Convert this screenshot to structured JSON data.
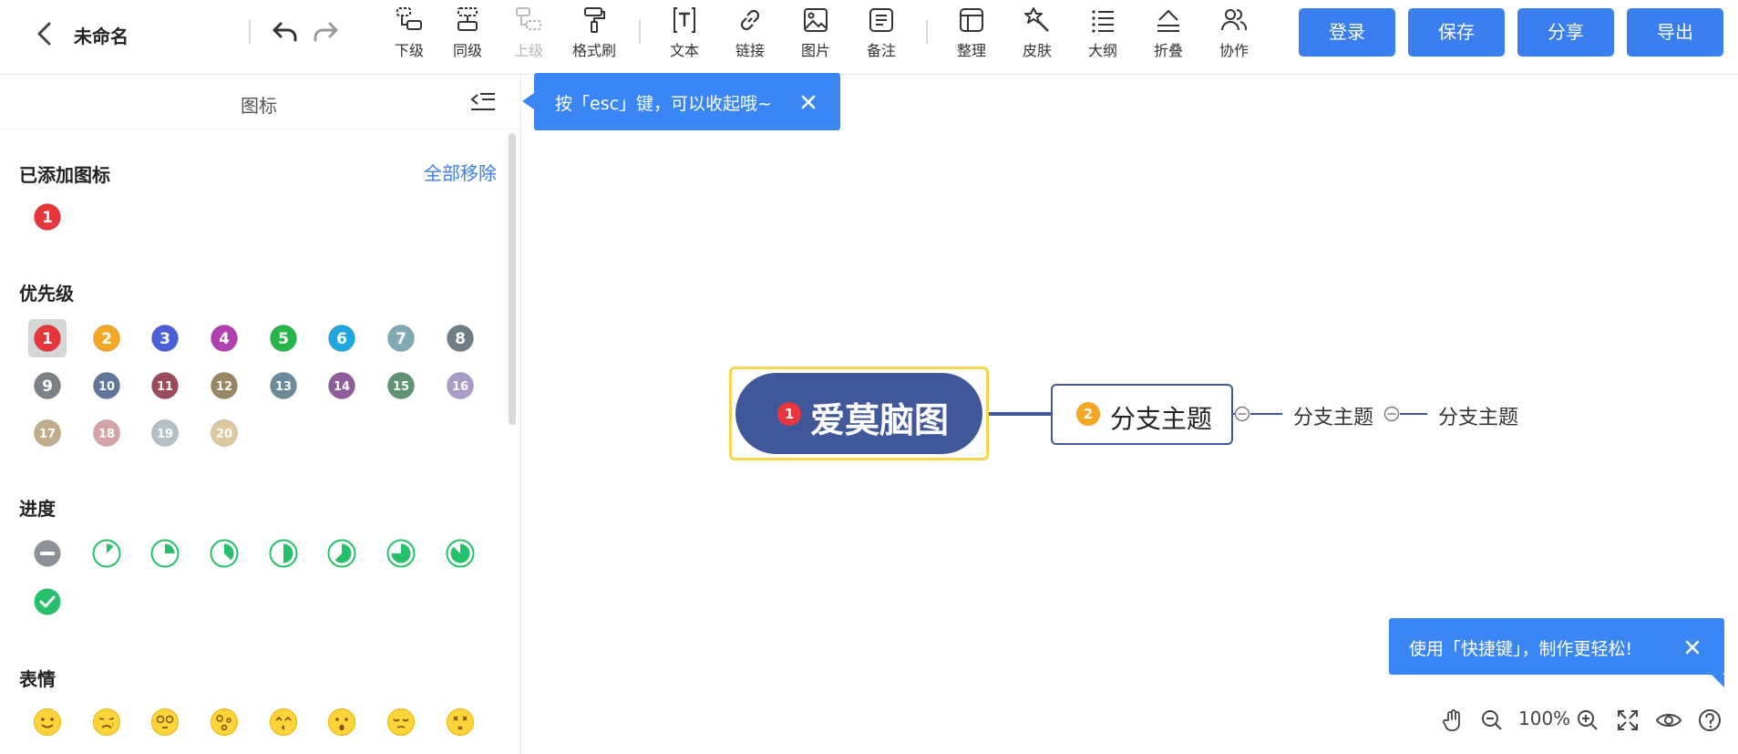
{
  "header": {
    "doc_title": "未命名",
    "tools": [
      {
        "label": "下级",
        "icon": "child-topic-icon"
      },
      {
        "label": "同级",
        "icon": "sibling-topic-icon"
      },
      {
        "label": "上级",
        "icon": "parent-topic-icon"
      },
      {
        "label": "格式刷",
        "icon": "format-brush-icon"
      },
      {
        "label": "文本",
        "icon": "text-icon"
      },
      {
        "label": "链接",
        "icon": "link-icon"
      },
      {
        "label": "图片",
        "icon": "image-icon"
      },
      {
        "label": "备注",
        "icon": "note-icon"
      },
      {
        "label": "整理",
        "icon": "layout-icon"
      },
      {
        "label": "皮肤",
        "icon": "skin-icon"
      },
      {
        "label": "大纲",
        "icon": "outline-icon"
      },
      {
        "label": "折叠",
        "icon": "fold-icon"
      },
      {
        "label": "协作",
        "icon": "collaborate-icon"
      }
    ],
    "buttons": {
      "login": "登录",
      "save": "保存",
      "share": "分享",
      "export": "导出"
    }
  },
  "sidebar": {
    "title": "图标",
    "added_title": "已添加图标",
    "remove_all": "全部移除",
    "added_icons": [
      "1"
    ],
    "priority_title": "优先级",
    "priority": [
      {
        "n": "1",
        "color": "#e8363c"
      },
      {
        "n": "2",
        "color": "#f5a623"
      },
      {
        "n": "3",
        "color": "#4a5fd8"
      },
      {
        "n": "4",
        "color": "#b23fb0"
      },
      {
        "n": "5",
        "color": "#27b54a"
      },
      {
        "n": "6",
        "color": "#1fa8e0"
      },
      {
        "n": "7",
        "color": "#7fa9b3"
      },
      {
        "n": "8",
        "color": "#6f7d86"
      },
      {
        "n": "9",
        "color": "#7a8288"
      },
      {
        "n": "10",
        "color": "#5f7799"
      },
      {
        "n": "11",
        "color": "#9b4b5c"
      },
      {
        "n": "12",
        "color": "#9a8662"
      },
      {
        "n": "13",
        "color": "#6a8a9c"
      },
      {
        "n": "14",
        "color": "#8e5d9a"
      },
      {
        "n": "15",
        "color": "#5e9470"
      },
      {
        "n": "16",
        "color": "#a99ac8"
      },
      {
        "n": "17",
        "color": "#c2ad8a"
      },
      {
        "n": "18",
        "color": "#d4a3a5"
      },
      {
        "n": "19",
        "color": "#b3c1c6"
      },
      {
        "n": "20",
        "color": "#dcc9a0"
      }
    ],
    "progress_title": "进度",
    "progress": [
      0,
      0.125,
      0.25,
      0.375,
      0.5,
      0.625,
      0.75,
      0.875,
      1
    ],
    "emotion_title": "表情",
    "emotions": [
      "smile-emoji-icon",
      "sad-emoji-icon",
      "dizzy-emoji-icon",
      "confused-emoji-icon",
      "kiss-emoji-icon",
      "surprised-emoji-icon",
      "sleepy-emoji-icon",
      "dead-emoji-icon"
    ]
  },
  "tips": {
    "esc_tip": "按「esc」键，可以收起哦~",
    "shortcut_tip": "使用「快捷键」，制作更轻松!"
  },
  "mindmap": {
    "root": {
      "text": "爱莫脑图",
      "badge": "1"
    },
    "branch": {
      "text": "分支主题",
      "badge": "2"
    },
    "subtopics": [
      "分支主题",
      "分支主题"
    ]
  },
  "zoom": {
    "level": "100%"
  },
  "colors": {
    "accent": "#3a7ef0",
    "node": "#40589a",
    "root_frame": "#f6d450",
    "progress_green": "#27c06a"
  }
}
